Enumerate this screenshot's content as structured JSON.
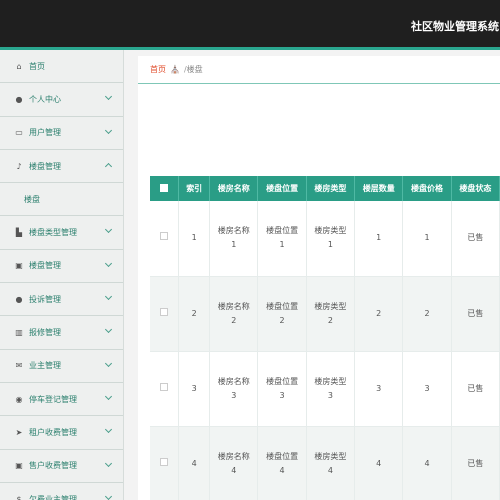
{
  "header": {
    "title": "社区物业管理系统"
  },
  "sidebar": {
    "items": [
      {
        "label": "首页",
        "icon": "home-icon",
        "glyph": "⌂",
        "arrow": ""
      },
      {
        "label": "个人中心",
        "icon": "user-icon",
        "glyph": "●",
        "arrow": "down"
      },
      {
        "label": "用户管理",
        "icon": "id-card-icon",
        "glyph": "▭",
        "arrow": "down"
      },
      {
        "label": "楼盘管理",
        "icon": "microphone-icon",
        "glyph": "♪",
        "arrow": "up"
      },
      {
        "label": "楼盘类型管理",
        "icon": "building-icon",
        "glyph": "▙",
        "arrow": "down"
      },
      {
        "label": "楼盘管理",
        "icon": "clipboard-icon",
        "glyph": "▣",
        "arrow": "down"
      },
      {
        "label": "投诉管理",
        "icon": "user-icon",
        "glyph": "●",
        "arrow": "down"
      },
      {
        "label": "报修管理",
        "icon": "chart-icon",
        "glyph": "▥",
        "arrow": "down"
      },
      {
        "label": "业主管理",
        "icon": "mail-icon",
        "glyph": "✉",
        "arrow": "down"
      },
      {
        "label": "停车登记管理",
        "icon": "location-icon",
        "glyph": "◉",
        "arrow": "down"
      },
      {
        "label": "租户收费管理",
        "icon": "send-icon",
        "glyph": "➤",
        "arrow": "down"
      },
      {
        "label": "售户收费管理",
        "icon": "clipboard-icon",
        "glyph": "▣",
        "arrow": "down"
      },
      {
        "label": "欠费业主管理",
        "icon": "money-icon",
        "glyph": "$",
        "arrow": "down"
      }
    ],
    "sub_item": "楼盘"
  },
  "breadcrumb": {
    "home": "首页",
    "sep": "/",
    "current": "楼盘"
  },
  "table": {
    "headers": [
      "",
      "索引",
      "楼房名称",
      "楼盘位置",
      "楼房类型",
      "楼层数量",
      "楼盘价格",
      "楼盘状态"
    ],
    "rows": [
      {
        "index": "1",
        "name": [
          "楼房名称",
          "1"
        ],
        "location": [
          "楼盘位置",
          "1"
        ],
        "type": [
          "楼房类型",
          "1"
        ],
        "floors": "1",
        "price": "1",
        "status": "已售"
      },
      {
        "index": "2",
        "name": [
          "楼房名称",
          "2"
        ],
        "location": [
          "楼盘位置",
          "2"
        ],
        "type": [
          "楼房类型",
          "2"
        ],
        "floors": "2",
        "price": "2",
        "status": "已售"
      },
      {
        "index": "3",
        "name": [
          "楼房名称",
          "3"
        ],
        "location": [
          "楼盘位置",
          "3"
        ],
        "type": [
          "楼房类型",
          "3"
        ],
        "floors": "3",
        "price": "3",
        "status": "已售"
      },
      {
        "index": "4",
        "name": [
          "楼房名称",
          "4"
        ],
        "location": [
          "楼盘位置",
          "4"
        ],
        "type": [
          "楼房类型",
          "4"
        ],
        "floors": "4",
        "price": "4",
        "status": "已售"
      }
    ]
  },
  "colors": {
    "accent": "#2a9d86",
    "topbar": "#1f1f1f",
    "breadcrumb_home": "#e04b2a"
  }
}
